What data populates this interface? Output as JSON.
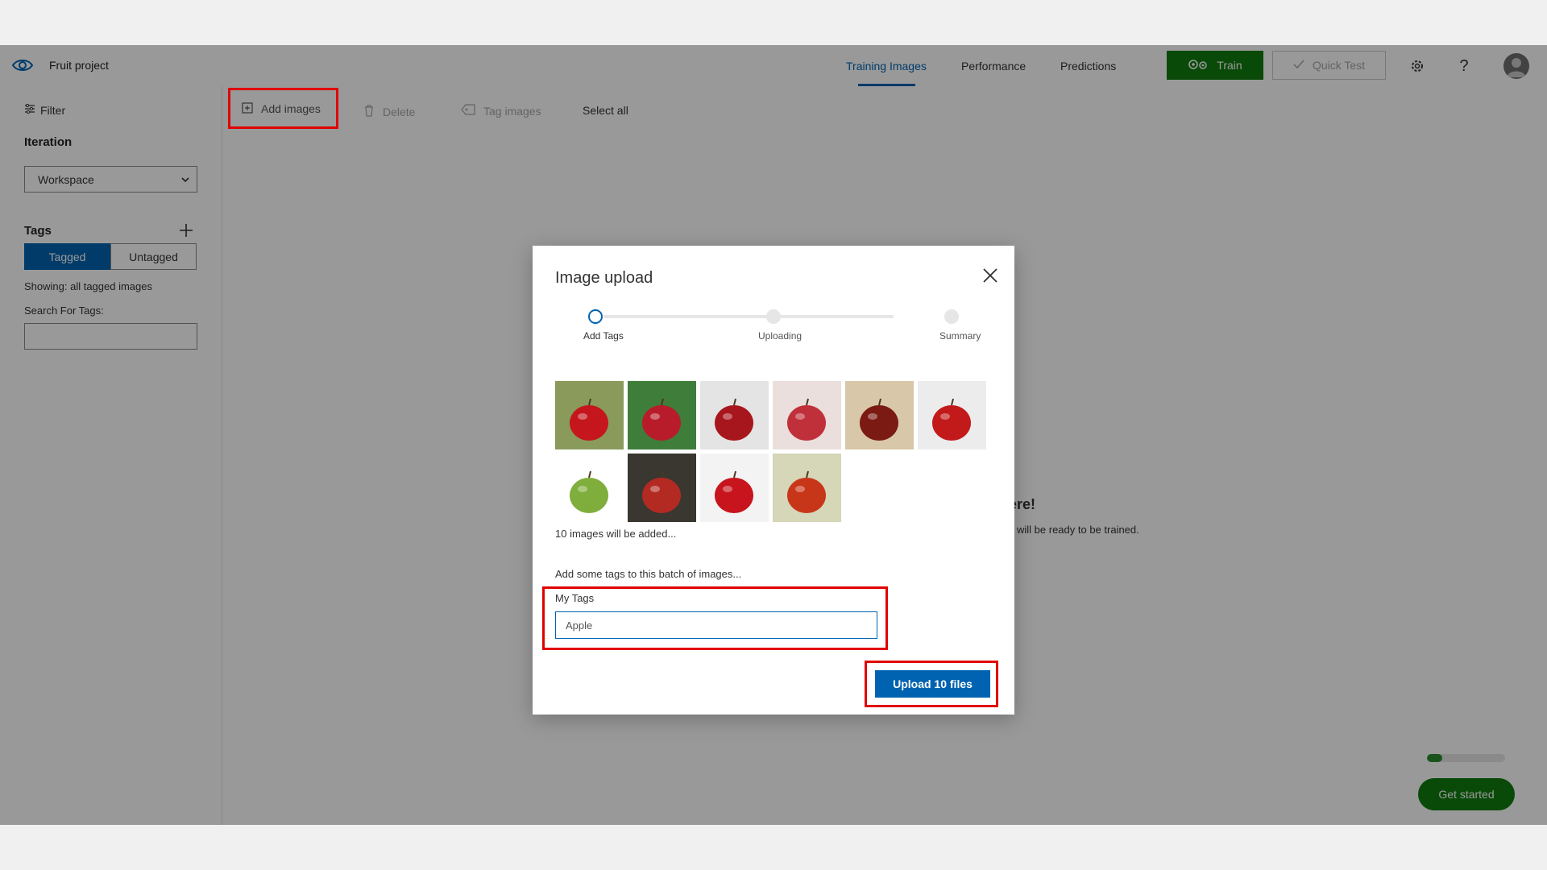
{
  "header": {
    "project_title": "Fruit project",
    "tabs": [
      {
        "label": "Training Images",
        "active": true
      },
      {
        "label": "Performance",
        "active": false
      },
      {
        "label": "Predictions",
        "active": false
      }
    ],
    "train_label": "Train",
    "quick_test_label": "Quick Test",
    "icons": [
      "eye-logo-icon",
      "gear-icon",
      "help-icon",
      "avatar-icon"
    ]
  },
  "toolbar": {
    "add_images": "Add images",
    "delete": "Delete",
    "tag_images": "Tag images",
    "select_all": "Select all"
  },
  "sidebar": {
    "filter_label": "Filter",
    "iteration_label": "Iteration",
    "iteration_value": "Workspace",
    "tags_label": "Tags",
    "toggle": {
      "tagged": "Tagged",
      "untagged": "Untagged",
      "selected": "Tagged"
    },
    "showing_text": "Showing: all tagged images",
    "search_label": "Search For Tags:",
    "search_value": ""
  },
  "background": {
    "heading_fragment": "ere!",
    "subtext_fragment": "will be ready to be trained.",
    "progress_fraction": 0.2,
    "get_started_label": "Get started"
  },
  "modal": {
    "title": "Image upload",
    "steps": [
      {
        "label": "Add Tags",
        "active": true
      },
      {
        "label": "Uploading",
        "active": false
      },
      {
        "label": "Summary",
        "active": false
      }
    ],
    "thumbnails": [
      {
        "bg": "#8a9a5b",
        "fruit": "#c4161c"
      },
      {
        "bg": "#3f7d3a",
        "fruit": "#b81c2a"
      },
      {
        "bg": "#e4e4e4",
        "fruit": "#a8161d"
      },
      {
        "bg": "#eadfdc",
        "fruit": "#c0303a"
      },
      {
        "bg": "#d8c7a8",
        "fruit": "#7a1a12"
      },
      {
        "bg": "#ececec",
        "fruit": "#c21a1a"
      },
      {
        "bg": "#ffffff",
        "fruit": "#7fae3c"
      },
      {
        "bg": "#3a3630",
        "fruit": "#b22a22"
      },
      {
        "bg": "#f3f3f3",
        "fruit": "#c7141d"
      },
      {
        "bg": "#d6d6b8",
        "fruit": "#c8361a"
      }
    ],
    "images_note": "10 images will be added...",
    "batch_label": "Add some tags to this batch of images...",
    "my_tags_label": "My Tags",
    "my_tags_value": "Apple",
    "upload_label": "Upload 10 files"
  },
  "colors": {
    "accent": "#0063b1",
    "train_green": "#107c10",
    "highlight_red": "#e00000"
  }
}
